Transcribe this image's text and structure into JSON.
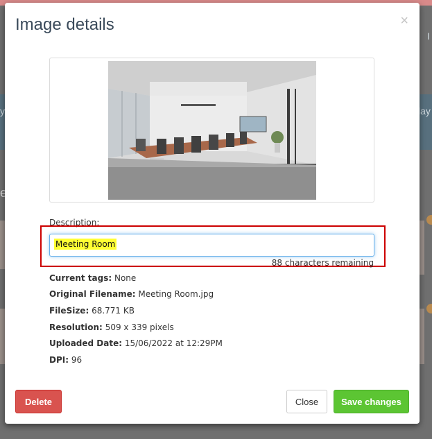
{
  "background": {
    "side_text_right_top": "I",
    "side_text_right_mid": "lay",
    "side_text_left_mid": "y",
    "side_text_left_lower": "e"
  },
  "modal": {
    "title": "Image details",
    "close_symbol": "×",
    "description_label": "Description:",
    "description_value": "Meeting Room",
    "chars_remaining": "88 characters remaining",
    "info": [
      {
        "label": "Current tags:",
        "value": "None"
      },
      {
        "label": "Original Filename:",
        "value": "Meeting Room.jpg"
      },
      {
        "label": "FileSize:",
        "value": "68.771 KB"
      },
      {
        "label": "Resolution:",
        "value": "509 x 339 pixels"
      },
      {
        "label": "Uploaded Date:",
        "value": "15/06/2022 at 12:29PM"
      },
      {
        "label": "DPI:",
        "value": "96"
      }
    ],
    "buttons": {
      "delete": "Delete",
      "close": "Close",
      "save": "Save changes"
    }
  },
  "colors": {
    "delete": "#d9534f",
    "save": "#5cc533",
    "highlight": "#ffff33",
    "annotation_box": "#cc0000"
  }
}
